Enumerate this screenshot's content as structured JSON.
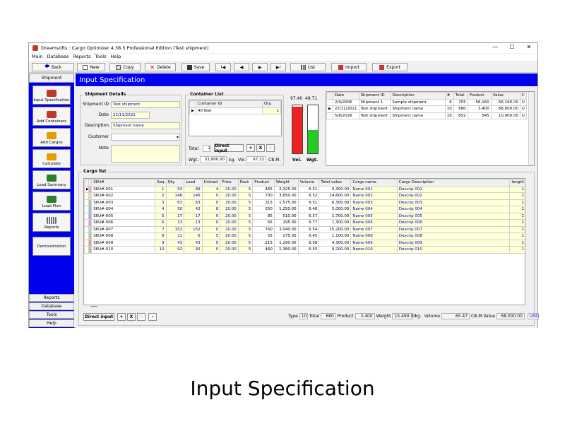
{
  "window": {
    "title": "Dreamsofts : Cargo Optimizer 4.38.5 Professional Edition  (Test shipment)",
    "controls": [
      "—",
      "☐",
      "✕"
    ]
  },
  "menu": [
    "Main",
    "Database",
    "Reports",
    "Tools",
    "Help"
  ],
  "toolbar": {
    "back": "Back",
    "new": "New",
    "copy": "Copy",
    "delete": "Delete",
    "save": "Save",
    "first": "I◀",
    "prev": "◀",
    "next": "▶",
    "last": "▶I",
    "list": "List",
    "import": "Import",
    "export": "Export"
  },
  "sidebar": {
    "header": "Shipment",
    "items": [
      {
        "label": "Input Specification",
        "color": "#c0392b"
      },
      {
        "label": "Add Containers",
        "color": "#c0392b"
      },
      {
        "label": "Add Cargos",
        "color": "#e69b00"
      },
      {
        "label": "Calculate",
        "color": "#e69b00"
      },
      {
        "label": "Load Summary",
        "color": "#2a7f2a"
      },
      {
        "label": "Load Plan",
        "color": "#2a7f2a"
      },
      {
        "label": "Reports",
        "color": "#607080"
      },
      {
        "label": "Demonstration",
        "color": ""
      }
    ],
    "footer": [
      "Reports",
      "Database",
      "Tools",
      "Help"
    ]
  },
  "page_title": "Input Specification",
  "shipment_details": {
    "title": "Shipment Details",
    "id_label": "Shipment ID",
    "id_value": "Test shipment",
    "date_label": "Date",
    "date_value": "22/11/2021",
    "desc_label": "Description",
    "desc_value": "Shipment name",
    "customer_label": "Customer",
    "customer_value": "",
    "note_label": "Note",
    "note_value": ""
  },
  "container_list": {
    "title": "Container List",
    "headers": [
      "Container ID",
      "Qty."
    ],
    "rows": [
      [
        "40 feet",
        "1"
      ]
    ],
    "total_label": "Total",
    "total_value": "1",
    "direct_input": "Direct input",
    "plus": "+",
    "x": "X",
    "edit": "✓",
    "wgt_label": "Wgt.",
    "wgt_value": "31,800.00",
    "wgt_unit": "kg.",
    "vol_label": "Vol.",
    "vol_value": "67.22",
    "vol_unit": "CB.M."
  },
  "gauges": {
    "vol_top": "97.40",
    "wgt_top": "48.71",
    "vol_label": "Vol.",
    "wgt_label": "Wgt.",
    "vol_fill_pct": 97.4,
    "wgt_fill_pct": 48.71
  },
  "shipment_table": {
    "headers": [
      "Date",
      "Shipment ID",
      "Description",
      "#",
      "Total",
      "Product",
      "Value",
      "C"
    ],
    "rows": [
      [
        "2/9/2006",
        "Shipment 1",
        "Sample shipment",
        "6",
        "755",
        "56,160",
        "56,160.00",
        "U"
      ],
      [
        "22/11/2021",
        "Test shipment",
        "Shipment name",
        "10",
        "680",
        "3,400",
        "68,000.00",
        "U"
      ],
      [
        "5/8/2026",
        "Test shipment",
        "Shipment name",
        "10",
        "652",
        "545",
        "10,900.00",
        "U"
      ]
    ]
  },
  "cargo_list": {
    "title": "Cargo list",
    "headers": [
      "SKU#",
      "Seq",
      "Qty.",
      "Load",
      "Unload",
      "Price",
      "Pack",
      "Product",
      "Weight",
      "Volume",
      "Total value",
      "Cargo name",
      "Cargo Description",
      "length"
    ],
    "rows": [
      {
        "color": "#e8b0b0",
        "cells": [
          "SKU#-001",
          "1",
          "93",
          "89",
          "4",
          "20.00",
          "5",
          "465",
          "2,325.00",
          "6.51",
          "9,300.00",
          "Name 001",
          "Descrip 001",
          "1"
        ]
      },
      {
        "color": "#e8e0a0",
        "cells": [
          "SKU#-002",
          "2",
          "146",
          "146",
          "0",
          "20.00",
          "5",
          "730",
          "3,650.00",
          "6.52",
          "14,600.00",
          "Name 002",
          "Descrip 002",
          "1"
        ]
      },
      {
        "color": "#a0d0a0",
        "cells": [
          "SKU#-003",
          "3",
          "63",
          "63",
          "0",
          "20.00",
          "5",
          "315",
          "1,575.00",
          "6.51",
          "6,300.00",
          "Name 003",
          "Descrip 003",
          "1"
        ]
      },
      {
        "color": "#a0b8e0",
        "cells": [
          "SKU#-004",
          "4",
          "50",
          "42",
          "8",
          "20.00",
          "5",
          "250",
          "1,250.00",
          "6.48",
          "5,000.00",
          "Name 004",
          "Descrip 004",
          "1"
        ]
      },
      {
        "color": "#c0a0e0",
        "cells": [
          "SKU#-005",
          "5",
          "17",
          "17",
          "0",
          "20.00",
          "5",
          "85",
          "510.00",
          "6.57",
          "1,700.00",
          "Name 005",
          "Descrip 005",
          "1"
        ]
      },
      {
        "color": "#e0a0c8",
        "cells": [
          "SKU#-006",
          "6",
          "13",
          "13",
          "0",
          "20.00",
          "5",
          "65",
          "195.00",
          "6.77",
          "1,300.00",
          "Name 006",
          "Descrip 006",
          "1"
        ]
      },
      {
        "color": "#a0e0d0",
        "cells": [
          "SKU#-007",
          "7",
          "152",
          "152",
          "0",
          "20.00",
          "5",
          "760",
          "3,040.00",
          "6.54",
          "15,200.00",
          "Name 007",
          "Descrip 007",
          "1"
        ]
      },
      {
        "color": "#d0c090",
        "cells": [
          "SKU#-008",
          "8",
          "11",
          "6",
          "5",
          "20.00",
          "5",
          "55",
          "275.00",
          "6.45",
          "1,100.00",
          "Name 008",
          "Descrip 008",
          "1"
        ]
      },
      {
        "color": "#e0a080",
        "cells": [
          "SKU#-009",
          "9",
          "43",
          "43",
          "0",
          "20.00",
          "5",
          "215",
          "1,290.00",
          "6.58",
          "4,300.00",
          "Name 009",
          "Descrip 009",
          "1"
        ]
      },
      {
        "color": "#b0c0a0",
        "cells": [
          "SKU#-010",
          "10",
          "92",
          "92",
          "0",
          "20.00",
          "5",
          "460",
          "1,380.00",
          "6.55",
          "9,200.00",
          "Name 010",
          "Descrip 010",
          "1"
        ]
      }
    ],
    "direct_input": "Direct input",
    "plus": "+",
    "x": "X",
    "edit": "✓",
    "minus": "-"
  },
  "status": {
    "type_label": "Type",
    "type_value": "10",
    "total_label": "Total",
    "total_value": "680",
    "product_label": "Product",
    "product_value": "3,400",
    "weight_label": "Weight",
    "weight_value": "15,490.00",
    "weight_unit": "kg.",
    "volume_label": "Volume",
    "volume_value": "65.47",
    "volume_unit": "CB.M",
    "value_label": "Value",
    "value_value": "68,000.00",
    "currency": "USD"
  },
  "caption": "Input Specification"
}
